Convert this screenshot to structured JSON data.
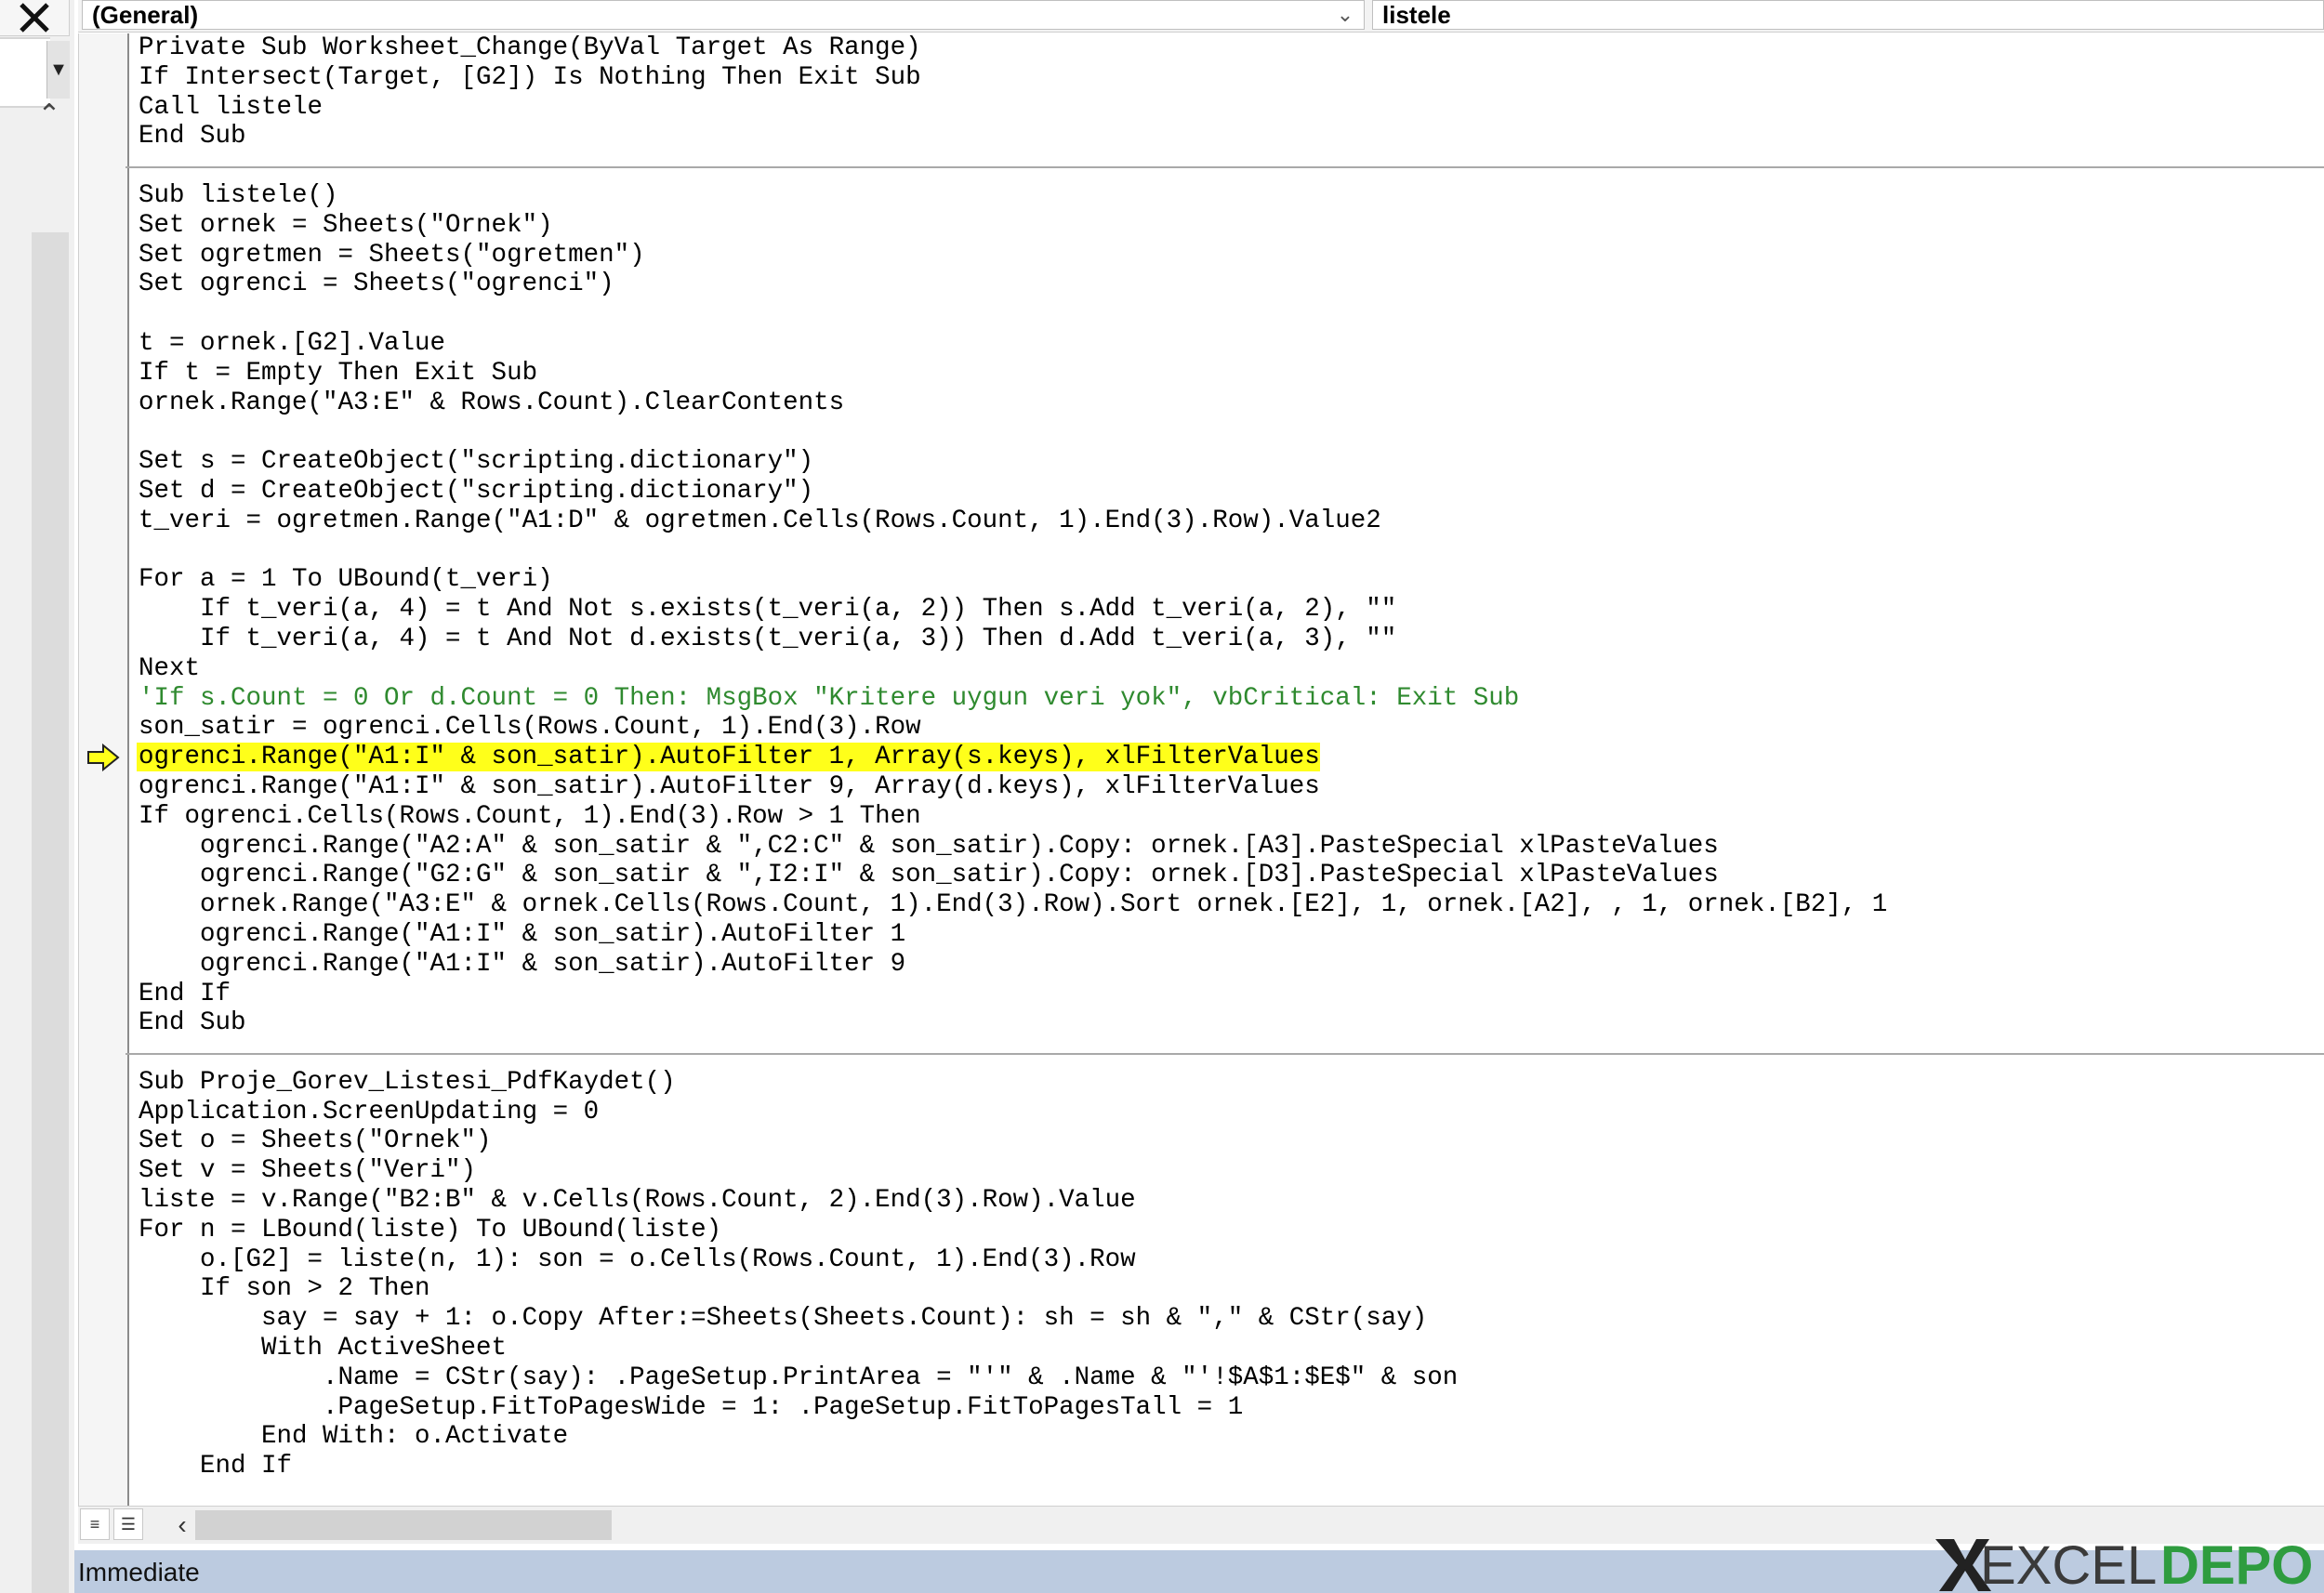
{
  "window": {
    "object_combo": "(General)",
    "procedure_combo": "listele"
  },
  "immediate_title": "Immediate",
  "watermark_text": [
    "EXCEL",
    "DEPO"
  ],
  "code_lines": [
    {
      "text": "Private Sub Worksheet_Change(ByVal Target As Range)"
    },
    {
      "text": "If Intersect(Target, [G2]) Is Nothing Then Exit Sub"
    },
    {
      "text": "Call listele"
    },
    {
      "text": "End Sub"
    },
    {
      "text": "",
      "separator": true
    },
    {
      "text": "Sub listele()"
    },
    {
      "text": "Set ornek = Sheets(\"Ornek\")"
    },
    {
      "text": "Set ogretmen = Sheets(\"ogretmen\")"
    },
    {
      "text": "Set ogrenci = Sheets(\"ogrenci\")"
    },
    {
      "text": ""
    },
    {
      "text": "t = ornek.[G2].Value"
    },
    {
      "text": "If t = Empty Then Exit Sub"
    },
    {
      "text": "ornek.Range(\"A3:E\" & Rows.Count).ClearContents"
    },
    {
      "text": ""
    },
    {
      "text": "Set s = CreateObject(\"scripting.dictionary\")"
    },
    {
      "text": "Set d = CreateObject(\"scripting.dictionary\")"
    },
    {
      "text": "t_veri = ogretmen.Range(\"A1:D\" & ogretmen.Cells(Rows.Count, 1).End(3).Row).Value2"
    },
    {
      "text": ""
    },
    {
      "text": "For a = 1 To UBound(t_veri)"
    },
    {
      "text": "    If t_veri(a, 4) = t And Not s.exists(t_veri(a, 2)) Then s.Add t_veri(a, 2), \"\""
    },
    {
      "text": "    If t_veri(a, 4) = t And Not d.exists(t_veri(a, 3)) Then d.Add t_veri(a, 3), \"\""
    },
    {
      "text": "Next"
    },
    {
      "text": "'If s.Count = 0 Or d.Count = 0 Then: MsgBox \"Kritere uygun veri yok\", vbCritical: Exit Sub",
      "comment": true
    },
    {
      "text": "son_satir = ogrenci.Cells(Rows.Count, 1).End(3).Row"
    },
    {
      "text": "ogrenci.Range(\"A1:I\" & son_satir).AutoFilter 1, Array(s.keys), xlFilterValues",
      "highlight": true
    },
    {
      "text": "ogrenci.Range(\"A1:I\" & son_satir).AutoFilter 9, Array(d.keys), xlFilterValues"
    },
    {
      "text": "If ogrenci.Cells(Rows.Count, 1).End(3).Row > 1 Then"
    },
    {
      "text": "    ogrenci.Range(\"A2:A\" & son_satir & \",C2:C\" & son_satir).Copy: ornek.[A3].PasteSpecial xlPasteValues"
    },
    {
      "text": "    ogrenci.Range(\"G2:G\" & son_satir & \",I2:I\" & son_satir).Copy: ornek.[D3].PasteSpecial xlPasteValues"
    },
    {
      "text": "    ornek.Range(\"A3:E\" & ornek.Cells(Rows.Count, 1).End(3).Row).Sort ornek.[E2], 1, ornek.[A2], , 1, ornek.[B2], 1"
    },
    {
      "text": "    ogrenci.Range(\"A1:I\" & son_satir).AutoFilter 1"
    },
    {
      "text": "    ogrenci.Range(\"A1:I\" & son_satir).AutoFilter 9"
    },
    {
      "text": "End If"
    },
    {
      "text": "End Sub"
    },
    {
      "text": "",
      "separator": true
    },
    {
      "text": "Sub Proje_Gorev_Listesi_PdfKaydet()"
    },
    {
      "text": "Application.ScreenUpdating = 0"
    },
    {
      "text": "Set o = Sheets(\"Ornek\")"
    },
    {
      "text": "Set v = Sheets(\"Veri\")"
    },
    {
      "text": "liste = v.Range(\"B2:B\" & v.Cells(Rows.Count, 2).End(3).Row).Value"
    },
    {
      "text": "For n = LBound(liste) To UBound(liste)"
    },
    {
      "text": "    o.[G2] = liste(n, 1): son = o.Cells(Rows.Count, 1).End(3).Row"
    },
    {
      "text": "    If son > 2 Then"
    },
    {
      "text": "        say = say + 1: o.Copy After:=Sheets(Sheets.Count): sh = sh & \",\" & CStr(say)"
    },
    {
      "text": "        With ActiveSheet"
    },
    {
      "text": "            .Name = CStr(say): .PageSetup.PrintArea = \"'\" & .Name & \"'!$A$1:$E$\" & son"
    },
    {
      "text": "            .PageSetup.FitToPagesWide = 1: .PageSetup.FitToPagesTall = 1"
    },
    {
      "text": "        End With: o.Activate"
    },
    {
      "text": "    End If"
    }
  ],
  "colors": {
    "highlight": "#ffff1a",
    "comment": "#2f8a2f",
    "immediate_bar": "#bccbe0",
    "watermark_excel": "#3a3a3a",
    "watermark_depo": "#2e9c3f"
  },
  "icons": [
    "close-icon",
    "dropdown-arrow-icon",
    "scroll-up-icon",
    "execution-pointer-icon",
    "procedure-view-icon",
    "full-module-view-icon",
    "scroll-left-icon"
  ]
}
